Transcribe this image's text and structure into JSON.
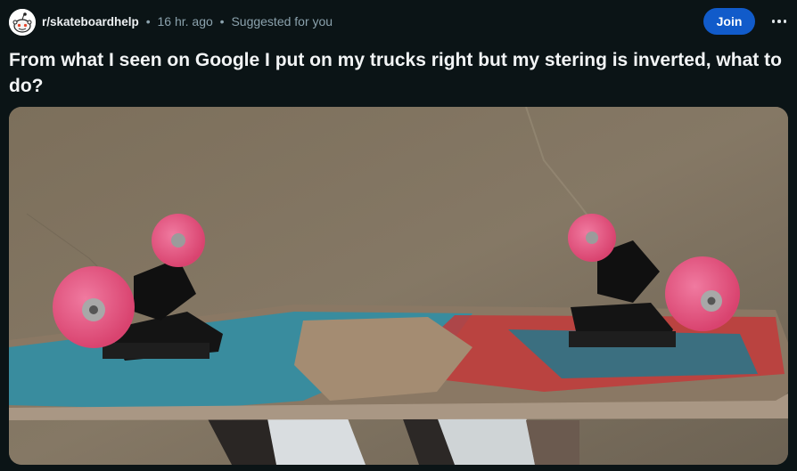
{
  "post": {
    "subreddit": "r/skateboardhelp",
    "separator": "•",
    "time": "16 hr. ago",
    "reason": "Suggested for you",
    "join_label": "Join",
    "title": "From what I seen on Google I put on my trucks right but my stering is inverted, what to do?"
  },
  "icons": {
    "avatar": "reddit-snoo-avatar",
    "overflow": "more-horizontal-icon"
  },
  "colors": {
    "background": "#0b1416",
    "join_button": "#115bca",
    "muted_text": "#8ba2ad"
  }
}
